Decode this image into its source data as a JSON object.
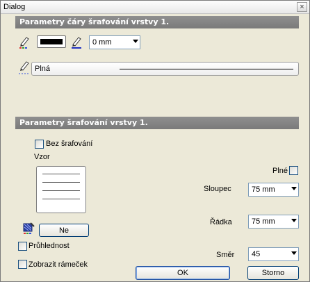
{
  "window": {
    "title": "Dialog",
    "close": "×"
  },
  "line_section": {
    "header": "Parametry čáry šrafování vrstvy 1.",
    "width_value": "0 mm",
    "style_value": "Plná"
  },
  "hatch_section": {
    "header": "Parametry šrafování vrstvy 1.",
    "no_hatch_label": "Bez šrafování",
    "pattern_label": "Vzor",
    "fill_button_label": "Ne",
    "transparency_label": "Průhlednost",
    "show_frame_label": "Zobrazit rámeček",
    "solid_label": "Plné",
    "column_label": "Sloupec",
    "column_value": "75 mm",
    "row_label": "Řádka",
    "row_value": "75 mm",
    "direction_label": "Směr",
    "direction_value": "45"
  },
  "footer": {
    "ok_label": "OK",
    "cancel_label": "Storno"
  },
  "colors": {
    "header_bg": "#808080",
    "dialog_bg": "#ece9d8",
    "line_color": "#000000"
  },
  "icons": [
    "pen-color-icon",
    "pen-width-icon",
    "pen-style-icon",
    "fill-icon"
  ]
}
